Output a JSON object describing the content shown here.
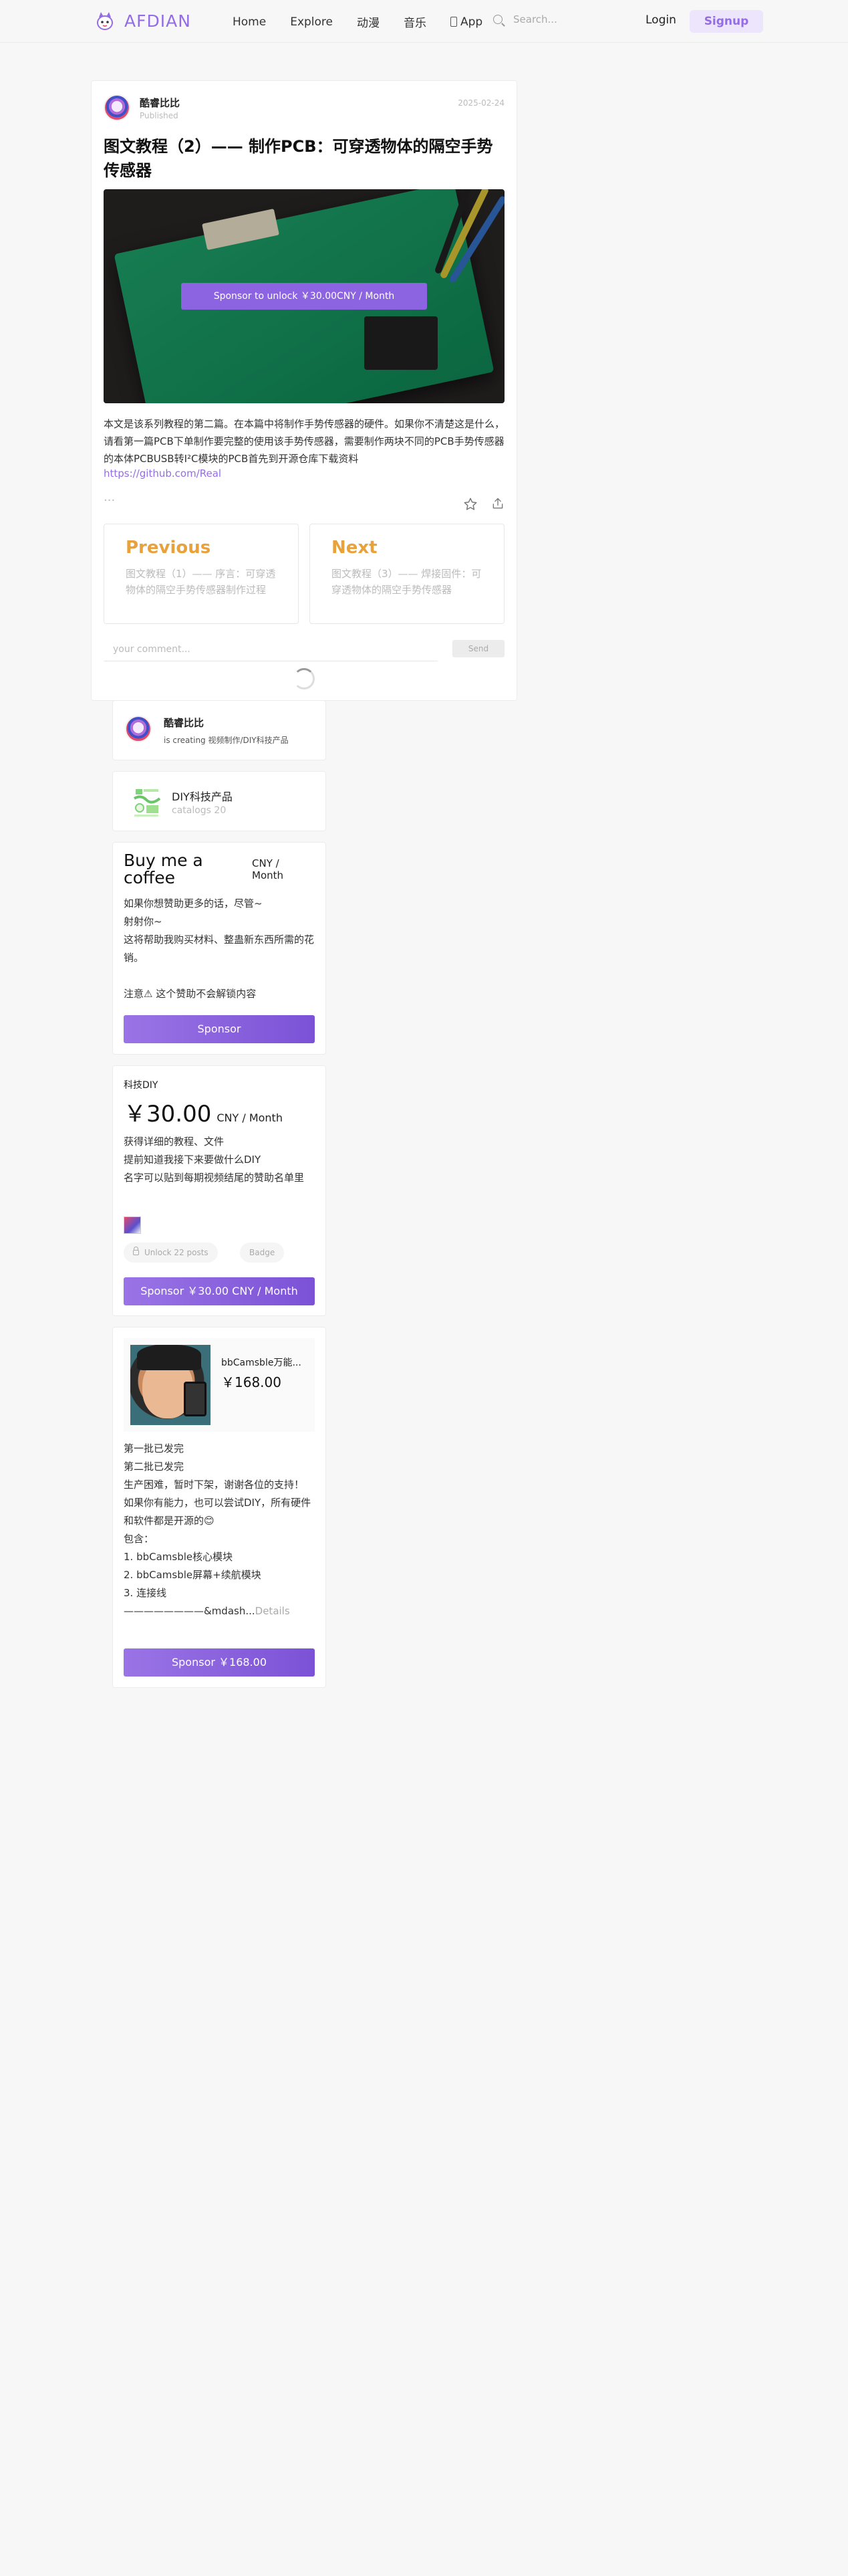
{
  "header": {
    "logo_text": "AFDIAN",
    "nav": [
      "Home",
      "Explore",
      "动漫",
      "音乐",
      "App"
    ],
    "search_placeholder": "Search...",
    "login": "Login",
    "signup": "Signup"
  },
  "post": {
    "author": "酷睿比比",
    "status": "Published",
    "date": "2025-02-24",
    "title": "图文教程（2）—— 制作PCB：可穿透物体的隔空手势传感器",
    "unlock_label": "Sponsor to unlock ￥30.00CNY / Month",
    "summary": "本文是该系列教程的第二篇。在本篇中将制作手势传感器的硬件。如果你不清楚这是什么，请看第一篇PCB下单制作要完整的使用该手势传感器，需要制作两块不同的PCB手势传感器的本体PCBUSB转I²C模块的PCB首先到开源仓库下载资料",
    "link": "https://github.com/Real",
    "ellipsis": "...",
    "prev_title": "Previous",
    "prev_desc": "图文教程（1）—— 序言：可穿透物体的隔空手势传感器制作过程",
    "next_title": "Next",
    "next_desc": "图文教程（3）—— 焊接固件：可穿透物体的隔空手势传感器",
    "comment_placeholder": "your comment...",
    "send": "Send"
  },
  "creator": {
    "name": "酷睿比比",
    "desc": "is creating 视频制作/DIY科技产品"
  },
  "category": {
    "name": "DIY科技产品",
    "count": "catalogs 20"
  },
  "coffee": {
    "title": "Buy me a coffee",
    "unit": "CNY / Month",
    "desc": "如果你想赞助更多的话，尽管~\n射射你~\n这将帮助我购买材料、整蛊新东西所需的花销。\n\n注意⚠ 这个赞助不会解锁内容",
    "button": "Sponsor"
  },
  "plan": {
    "name": "科技DIY",
    "price": "￥30.00",
    "unit": "CNY / Month",
    "desc": "获得详细的教程、文件\n提前知道我接下来要做什么DIY\n名字可以贴到每期视频结尾的赞助名单里",
    "tag_unlock": "Unlock 22 posts",
    "tag_badge": "Badge",
    "button": "Sponsor ￥30.00 CNY / Month"
  },
  "product": {
    "name": "bbCamsble万能...",
    "price": "￥168.00",
    "desc": "第一批已发完\n第二批已发完\n生产困难，暂时下架，谢谢各位的支持！\n如果你有能力，也可以尝试DIY，所有硬件和软件都是开源的😊\n包含：\n1. bbCamsble核心模块\n2. bbCamsble屏幕+续航模块\n3. 连接线\n————————&mdash...",
    "details": "Details",
    "button": "Sponsor ￥168.00"
  },
  "colors": {
    "brand": "#946ce6",
    "accent_orange": "#e9a13c",
    "button_gradient_start": "#9a74e6",
    "button_gradient_end": "#7b52d6"
  }
}
